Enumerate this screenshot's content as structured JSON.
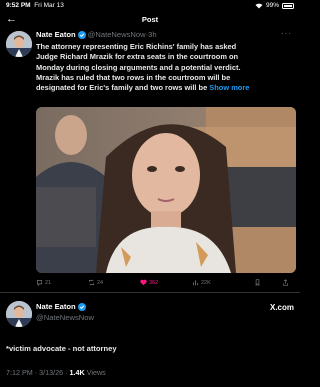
{
  "status_bar": {
    "time": "9:52 PM",
    "date": "Fri Mar 13",
    "battery": "99%"
  },
  "header": {
    "title": "Post",
    "back_icon": "arrow-left-icon"
  },
  "post": {
    "author_name": "Nate Eaton",
    "handle": "@NateNewsNow",
    "age": "3h",
    "separator": "·",
    "text_lines": [
      "The attorney representing Eric Richins' family has asked",
      "Judge Richard Mrazik for extra seats in the courtroom on",
      "Monday during closing arguments and a potential verdict.",
      "Mrazik has ruled that two rows in the courtroom will be",
      "designated for Eric's family and two rows will be"
    ],
    "show_more": "Show more",
    "actions": {
      "replies": "21",
      "reposts": "24",
      "likes": "362",
      "views": "22K"
    },
    "colors": {
      "like": "#f91880",
      "link": "#1d9bf0",
      "verified": "#1d9bf0"
    }
  },
  "embed": {
    "author_name": "Nate Eaton",
    "handle": "@NateNewsNow",
    "source": "X.com",
    "text": "*victim advocate - not attorney",
    "time": "7:12 PM",
    "date": "3/13/26",
    "views_count": "1.4K",
    "views_label": "Views"
  }
}
